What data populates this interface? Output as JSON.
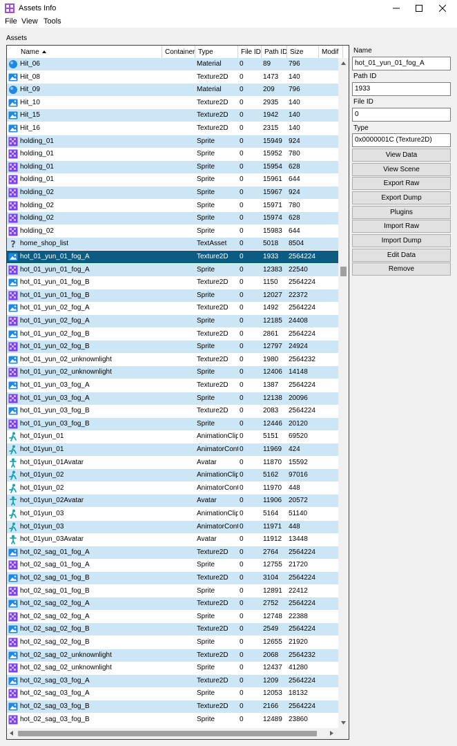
{
  "window": {
    "title": "Assets Info"
  },
  "menu": [
    "File",
    "View",
    "Tools"
  ],
  "assets_label": "Assets",
  "columns": {
    "name": "Name",
    "container": "Container",
    "type": "Type",
    "file_id": "File ID",
    "path_id": "Path ID",
    "size": "Size",
    "modified": "Modif"
  },
  "rows": [
    {
      "icon": "material",
      "name": "Hit_06",
      "type": "Material",
      "file_id": "0",
      "path_id": "89",
      "size": "796"
    },
    {
      "icon": "texture",
      "name": "Hit_08",
      "type": "Texture2D",
      "file_id": "0",
      "path_id": "1473",
      "size": "140"
    },
    {
      "icon": "material",
      "name": "Hit_09",
      "type": "Material",
      "file_id": "0",
      "path_id": "209",
      "size": "796"
    },
    {
      "icon": "texture",
      "name": "Hit_10",
      "type": "Texture2D",
      "file_id": "0",
      "path_id": "2935",
      "size": "140"
    },
    {
      "icon": "texture",
      "name": "Hit_15",
      "type": "Texture2D",
      "file_id": "0",
      "path_id": "1942",
      "size": "140"
    },
    {
      "icon": "texture",
      "name": "Hit_16",
      "type": "Texture2D",
      "file_id": "0",
      "path_id": "2315",
      "size": "140"
    },
    {
      "icon": "sprite",
      "name": "holding_01",
      "type": "Sprite",
      "file_id": "0",
      "path_id": "15949",
      "size": "924"
    },
    {
      "icon": "sprite",
      "name": "holding_01",
      "type": "Sprite",
      "file_id": "0",
      "path_id": "15952",
      "size": "780"
    },
    {
      "icon": "sprite",
      "name": "holding_01",
      "type": "Sprite",
      "file_id": "0",
      "path_id": "15954",
      "size": "628"
    },
    {
      "icon": "sprite",
      "name": "holding_01",
      "type": "Sprite",
      "file_id": "0",
      "path_id": "15961",
      "size": "644"
    },
    {
      "icon": "sprite",
      "name": "holding_02",
      "type": "Sprite",
      "file_id": "0",
      "path_id": "15967",
      "size": "924"
    },
    {
      "icon": "sprite",
      "name": "holding_02",
      "type": "Sprite",
      "file_id": "0",
      "path_id": "15971",
      "size": "780"
    },
    {
      "icon": "sprite",
      "name": "holding_02",
      "type": "Sprite",
      "file_id": "0",
      "path_id": "15974",
      "size": "628"
    },
    {
      "icon": "sprite",
      "name": "holding_02",
      "type": "Sprite",
      "file_id": "0",
      "path_id": "15983",
      "size": "644"
    },
    {
      "icon": "unknown",
      "name": "home_shop_list",
      "type": "TextAsset",
      "file_id": "0",
      "path_id": "5018",
      "size": "8504"
    },
    {
      "icon": "texture",
      "name": "hot_01_yun_01_fog_A",
      "type": "Texture2D",
      "file_id": "0",
      "path_id": "1933",
      "size": "2564224",
      "selected": true
    },
    {
      "icon": "sprite",
      "name": "hot_01_yun_01_fog_A",
      "type": "Sprite",
      "file_id": "0",
      "path_id": "12383",
      "size": "22540"
    },
    {
      "icon": "texture",
      "name": "hot_01_yun_01_fog_B",
      "type": "Texture2D",
      "file_id": "0",
      "path_id": "1150",
      "size": "2564224"
    },
    {
      "icon": "sprite",
      "name": "hot_01_yun_01_fog_B",
      "type": "Sprite",
      "file_id": "0",
      "path_id": "12027",
      "size": "22372"
    },
    {
      "icon": "texture",
      "name": "hot_01_yun_02_fog_A",
      "type": "Texture2D",
      "file_id": "0",
      "path_id": "1492",
      "size": "2564224"
    },
    {
      "icon": "sprite",
      "name": "hot_01_yun_02_fog_A",
      "type": "Sprite",
      "file_id": "0",
      "path_id": "12185",
      "size": "24408"
    },
    {
      "icon": "texture",
      "name": "hot_01_yun_02_fog_B",
      "type": "Texture2D",
      "file_id": "0",
      "path_id": "2861",
      "size": "2564224"
    },
    {
      "icon": "sprite",
      "name": "hot_01_yun_02_fog_B",
      "type": "Sprite",
      "file_id": "0",
      "path_id": "12797",
      "size": "24924"
    },
    {
      "icon": "texture",
      "name": "hot_01_yun_02_unknownlight",
      "type": "Texture2D",
      "file_id": "0",
      "path_id": "1980",
      "size": "2564232"
    },
    {
      "icon": "sprite",
      "name": "hot_01_yun_02_unknownlight",
      "type": "Sprite",
      "file_id": "0",
      "path_id": "12406",
      "size": "14148"
    },
    {
      "icon": "texture",
      "name": "hot_01_yun_03_fog_A",
      "type": "Texture2D",
      "file_id": "0",
      "path_id": "1387",
      "size": "2564224"
    },
    {
      "icon": "sprite",
      "name": "hot_01_yun_03_fog_A",
      "type": "Sprite",
      "file_id": "0",
      "path_id": "12138",
      "size": "20096"
    },
    {
      "icon": "texture",
      "name": "hot_01_yun_03_fog_B",
      "type": "Texture2D",
      "file_id": "0",
      "path_id": "2083",
      "size": "2564224"
    },
    {
      "icon": "sprite",
      "name": "hot_01_yun_03_fog_B",
      "type": "Sprite",
      "file_id": "0",
      "path_id": "12446",
      "size": "20120"
    },
    {
      "icon": "anim",
      "name": "hot_01yun_01",
      "type": "AnimationClip",
      "file_id": "0",
      "path_id": "5151",
      "size": "69520"
    },
    {
      "icon": "anim",
      "name": "hot_01yun_01",
      "type": "AnimatorController",
      "file_id": "0",
      "path_id": "11969",
      "size": "424"
    },
    {
      "icon": "avatar",
      "name": "hot_01yun_01Avatar",
      "type": "Avatar",
      "file_id": "0",
      "path_id": "11870",
      "size": "15592"
    },
    {
      "icon": "anim",
      "name": "hot_01yun_02",
      "type": "AnimationClip",
      "file_id": "0",
      "path_id": "5162",
      "size": "97016"
    },
    {
      "icon": "anim",
      "name": "hot_01yun_02",
      "type": "AnimatorController",
      "file_id": "0",
      "path_id": "11970",
      "size": "448"
    },
    {
      "icon": "avatar",
      "name": "hot_01yun_02Avatar",
      "type": "Avatar",
      "file_id": "0",
      "path_id": "11906",
      "size": "20572"
    },
    {
      "icon": "anim",
      "name": "hot_01yun_03",
      "type": "AnimationClip",
      "file_id": "0",
      "path_id": "5164",
      "size": "51140"
    },
    {
      "icon": "anim",
      "name": "hot_01yun_03",
      "type": "AnimatorController",
      "file_id": "0",
      "path_id": "11971",
      "size": "448"
    },
    {
      "icon": "avatar",
      "name": "hot_01yun_03Avatar",
      "type": "Avatar",
      "file_id": "0",
      "path_id": "11912",
      "size": "13448"
    },
    {
      "icon": "texture",
      "name": "hot_02_sag_01_fog_A",
      "type": "Texture2D",
      "file_id": "0",
      "path_id": "2764",
      "size": "2564224"
    },
    {
      "icon": "sprite",
      "name": "hot_02_sag_01_fog_A",
      "type": "Sprite",
      "file_id": "0",
      "path_id": "12755",
      "size": "21720"
    },
    {
      "icon": "texture",
      "name": "hot_02_sag_01_fog_B",
      "type": "Texture2D",
      "file_id": "0",
      "path_id": "3104",
      "size": "2564224"
    },
    {
      "icon": "sprite",
      "name": "hot_02_sag_01_fog_B",
      "type": "Sprite",
      "file_id": "0",
      "path_id": "12891",
      "size": "22412"
    },
    {
      "icon": "texture",
      "name": "hot_02_sag_02_fog_A",
      "type": "Texture2D",
      "file_id": "0",
      "path_id": "2752",
      "size": "2564224"
    },
    {
      "icon": "sprite",
      "name": "hot_02_sag_02_fog_A",
      "type": "Sprite",
      "file_id": "0",
      "path_id": "12748",
      "size": "22388"
    },
    {
      "icon": "texture",
      "name": "hot_02_sag_02_fog_B",
      "type": "Texture2D",
      "file_id": "0",
      "path_id": "2549",
      "size": "2564224"
    },
    {
      "icon": "sprite",
      "name": "hot_02_sag_02_fog_B",
      "type": "Sprite",
      "file_id": "0",
      "path_id": "12655",
      "size": "21920"
    },
    {
      "icon": "texture",
      "name": "hot_02_sag_02_unknownlight",
      "type": "Texture2D",
      "file_id": "0",
      "path_id": "2068",
      "size": "2564232"
    },
    {
      "icon": "sprite",
      "name": "hot_02_sag_02_unknownlight",
      "type": "Sprite",
      "file_id": "0",
      "path_id": "12437",
      "size": "41280"
    },
    {
      "icon": "texture",
      "name": "hot_02_sag_03_fog_A",
      "type": "Texture2D",
      "file_id": "0",
      "path_id": "1209",
      "size": "2564224"
    },
    {
      "icon": "sprite",
      "name": "hot_02_sag_03_fog_A",
      "type": "Sprite",
      "file_id": "0",
      "path_id": "12053",
      "size": "18132"
    },
    {
      "icon": "texture",
      "name": "hot_02_sag_03_fog_B",
      "type": "Texture2D",
      "file_id": "0",
      "path_id": "2166",
      "size": "2564224"
    },
    {
      "icon": "sprite",
      "name": "hot_02_sag_03_fog_B",
      "type": "Sprite",
      "file_id": "0",
      "path_id": "12489",
      "size": "23860"
    }
  ],
  "panel": {
    "name_label": "Name",
    "name_value": "hot_01_yun_01_fog_A",
    "path_id_label": "Path ID",
    "path_id_value": "1933",
    "file_id_label": "File ID",
    "file_id_value": "0",
    "type_label": "Type",
    "type_value": "0x0000001C (Texture2D)",
    "buttons": [
      "View Data",
      "View Scene",
      "Export Raw",
      "Export Dump",
      "Plugins",
      "Import Raw",
      "Import Dump",
      "Edit Data",
      "Remove"
    ]
  },
  "colors": {
    "row_alt": "#cde6f6",
    "row_selected": "#0c5c82",
    "icon_blue": "#1e88e5",
    "sprite_purple": "#7e3ff2",
    "avatar_teal": "#17a2b8"
  }
}
